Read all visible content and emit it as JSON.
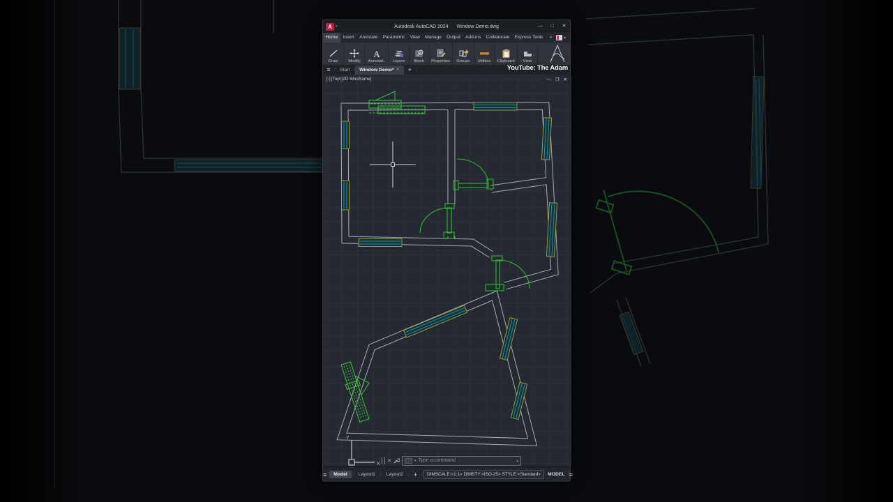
{
  "colors": {
    "canvas_bg": "#252a32",
    "wall_gray": "#a6adb6",
    "window_frame_yellow": "#a9a63e",
    "window_glass_teal": "#2e8e96",
    "door_green": "#2db92d",
    "selection_green": "#3cc63c",
    "app_badge_red": "#c01d45",
    "crosshair": "#d2d6dc"
  },
  "title_bar": {
    "app_icon": "A",
    "product": "Autodesk AutoCAD 2024",
    "filename": "Window Demo.dwg",
    "minimize": "—",
    "maximize": "□",
    "close": "✕"
  },
  "ribbon": {
    "tabs": [
      {
        "label": "Home",
        "active": true
      },
      {
        "label": "Insert"
      },
      {
        "label": "Annotate"
      },
      {
        "label": "Parametric"
      },
      {
        "label": "View"
      },
      {
        "label": "Manage"
      },
      {
        "label": "Output"
      },
      {
        "label": "Add-ins"
      },
      {
        "label": "Collaborate"
      },
      {
        "label": "Express Tools"
      }
    ],
    "overflow": "»",
    "overflow_caret": "▾",
    "panels": [
      {
        "label": "Draw",
        "icon": "line-icon"
      },
      {
        "label": "Modify",
        "icon": "move-icon"
      },
      {
        "label": "Annotati..",
        "icon": "text-a-icon"
      },
      {
        "label": "Layers",
        "icon": "layers-icon"
      },
      {
        "label": "Block",
        "icon": "block-icon"
      },
      {
        "label": "Properties",
        "icon": "properties-icon"
      },
      {
        "label": "Groups",
        "icon": "groups-icon"
      },
      {
        "label": "Utilities",
        "icon": "ruler-icon"
      },
      {
        "label": "Clipboard",
        "icon": "clipboard-icon"
      },
      {
        "label": "View",
        "icon": "view-icon"
      }
    ]
  },
  "watermark": "YouTube: The Adam",
  "file_tabs": {
    "menu_icon": "≡",
    "slash": "/",
    "tabs": [
      {
        "label": "Start",
        "active": false
      },
      {
        "label": "Window Demo*",
        "active": true,
        "close": "✕"
      }
    ],
    "add": "+"
  },
  "viewport": {
    "controls": [
      "[-]",
      "[Top]",
      "[2D Wireframe]"
    ],
    "buttons": {
      "minimize": "—",
      "restore": "❐",
      "close": "✕"
    }
  },
  "ucs": {
    "y_label": "Y",
    "x_label": "X"
  },
  "command_line": {
    "close": "✕",
    "icon_caret": "▾",
    "placeholder": "Type a command",
    "history_caret": "▴"
  },
  "status_bar": {
    "menu_icon": "≡",
    "slash": "/",
    "tabs": [
      {
        "label": "Model",
        "active": true
      },
      {
        "label": "Layout1"
      },
      {
        "label": "Layout2"
      }
    ],
    "add": "+",
    "settings": "DIMSCALE:<1:1> DIMSTY:<ISO-25> STYLE:<Standard>",
    "mode": "MODEL",
    "right_menu_icon": "≡"
  }
}
